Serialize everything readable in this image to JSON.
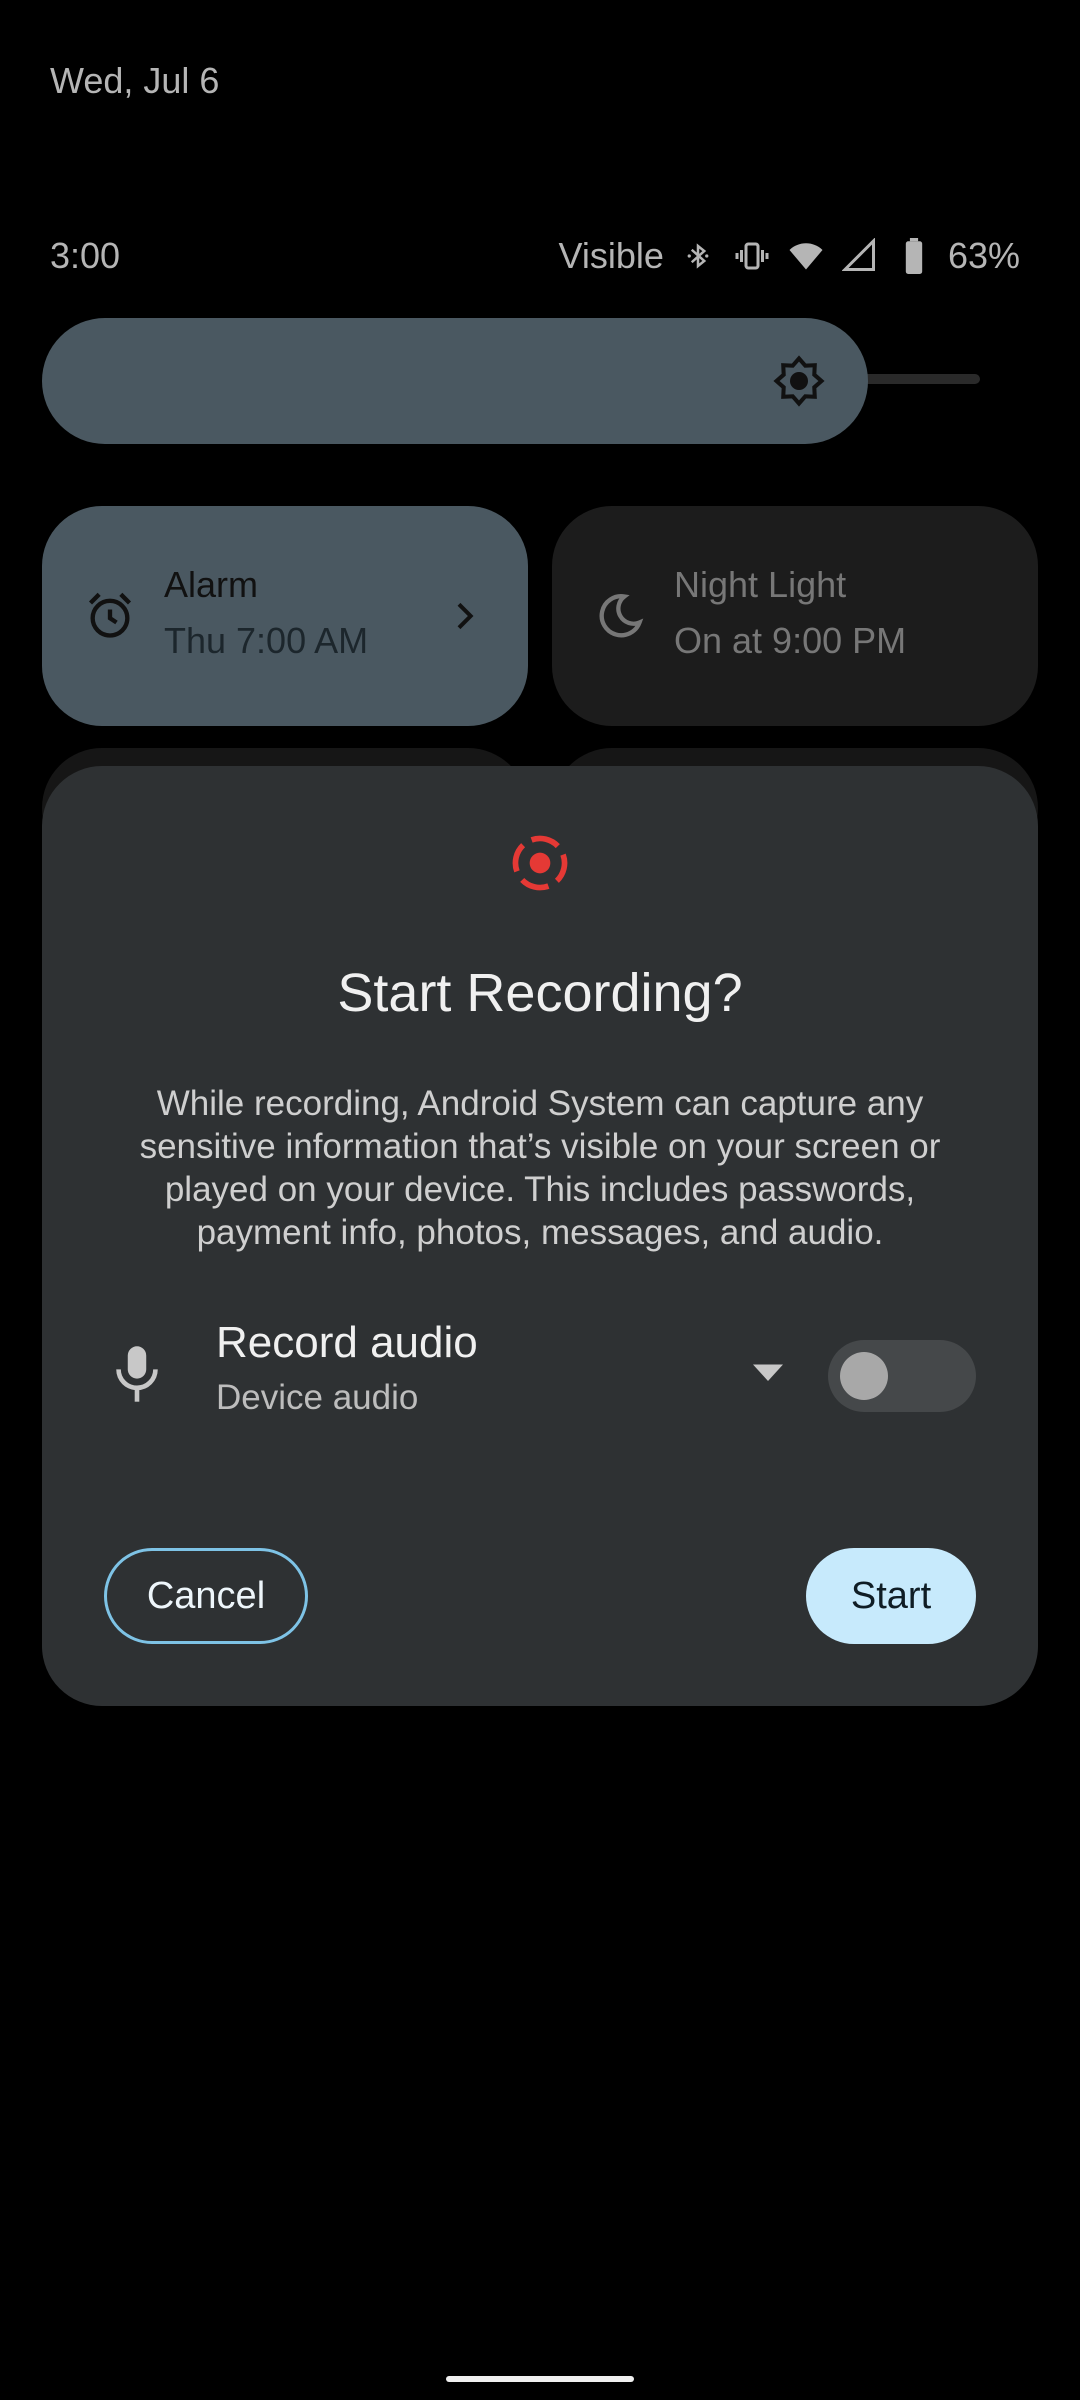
{
  "shade": {
    "date": "Wed, Jul 6",
    "time": "3:00",
    "status_label": "Visible",
    "battery_percent": "63%",
    "icons": [
      "bluetooth-icon",
      "vibrate-icon",
      "wifi-icon",
      "cell-signal-icon",
      "battery-icon"
    ]
  },
  "tiles": [
    {
      "title": "Alarm",
      "subtitle": "Thu 7:00 AM",
      "icon": "alarm-icon"
    },
    {
      "title": "Night Light",
      "subtitle": "On at 9:00 PM",
      "icon": "moon-icon"
    }
  ],
  "dialog": {
    "title": "Start Recording?",
    "body": "While recording, Android System can capture any sensitive information that’s visible on your screen or played on your device. This includes passwords, payment info, photos, messages, and audio.",
    "audio_option": {
      "title": "Record audio",
      "source": "Device audio",
      "enabled": false
    },
    "cancel_label": "Cancel",
    "start_label": "Start"
  },
  "colors": {
    "accent_red": "#e53935",
    "tile_active": "#4a5861",
    "start_button": "#c7eafc",
    "cancel_border": "#7ec3e6"
  }
}
